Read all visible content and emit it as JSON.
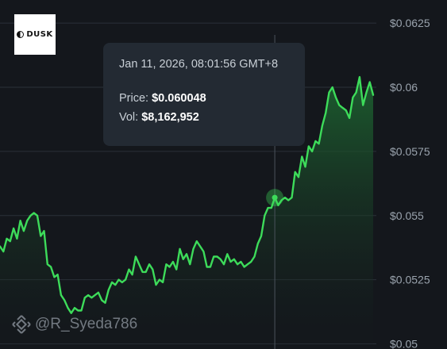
{
  "logo": {
    "text": "DUSK"
  },
  "tooltip": {
    "datetime": "Jan 11, 2026, 08:01:56 GMT+8",
    "price_label": "Price:",
    "price_value": "$0.060048",
    "vol_label": "Vol:",
    "vol_value": "$8,162,952"
  },
  "watermark": {
    "handle": "@R_Syeda786",
    "icon": "binance-logo-icon"
  },
  "colors": {
    "background": "#14171c",
    "line": "#3ddc5a",
    "area_top": "#1e6a32",
    "grid": "#2a3038",
    "crosshair": "#4a525c"
  },
  "chart_data": {
    "type": "area",
    "title": "",
    "xlabel": "",
    "ylabel": "",
    "ylim": [
      0.0498,
      0.0634
    ],
    "yticks": [
      {
        "value": 0.0625,
        "label": "$0.0625"
      },
      {
        "value": 0.06,
        "label": "$0.06"
      },
      {
        "value": 0.0575,
        "label": "$0.0575"
      },
      {
        "value": 0.055,
        "label": "$0.055"
      },
      {
        "value": 0.0525,
        "label": "$0.0525"
      },
      {
        "value": 0.05,
        "label": "$0.05"
      }
    ],
    "grid": true,
    "highlight_index": 81,
    "series": [
      {
        "values": [
          0.0538,
          0.0536,
          0.0541,
          0.054,
          0.0545,
          0.0541,
          0.0548,
          0.0544,
          0.0548,
          0.055,
          0.0551,
          0.055,
          0.0542,
          0.0544,
          0.0531,
          0.053,
          0.0526,
          0.0527,
          0.0519,
          0.0517,
          0.0514,
          0.0512,
          0.0514,
          0.0513,
          0.0513,
          0.0518,
          0.0519,
          0.0518,
          0.0519,
          0.052,
          0.0517,
          0.0516,
          0.0521,
          0.0524,
          0.0523,
          0.0525,
          0.0524,
          0.0525,
          0.0529,
          0.0527,
          0.0534,
          0.0531,
          0.0528,
          0.0528,
          0.0531,
          0.0529,
          0.0523,
          0.0525,
          0.0524,
          0.0531,
          0.053,
          0.0532,
          0.0529,
          0.0537,
          0.0533,
          0.0535,
          0.0531,
          0.0537,
          0.054,
          0.0538,
          0.0536,
          0.053,
          0.053,
          0.0534,
          0.0534,
          0.0533,
          0.0531,
          0.0535,
          0.0532,
          0.0533,
          0.0531,
          0.0532,
          0.053,
          0.0531,
          0.0532,
          0.0534,
          0.0539,
          0.0542,
          0.055,
          0.0553,
          0.0553,
          0.0557,
          0.0554,
          0.0556,
          0.0557,
          0.0556,
          0.0557,
          0.0567,
          0.0565,
          0.0573,
          0.0569,
          0.0577,
          0.0575,
          0.0579,
          0.0578,
          0.0585,
          0.059,
          0.0598,
          0.06,
          0.0596,
          0.0593,
          0.0592,
          0.0591,
          0.0588,
          0.0596,
          0.0598,
          0.0604,
          0.0593,
          0.0598,
          0.0602,
          0.0597
        ]
      }
    ]
  }
}
